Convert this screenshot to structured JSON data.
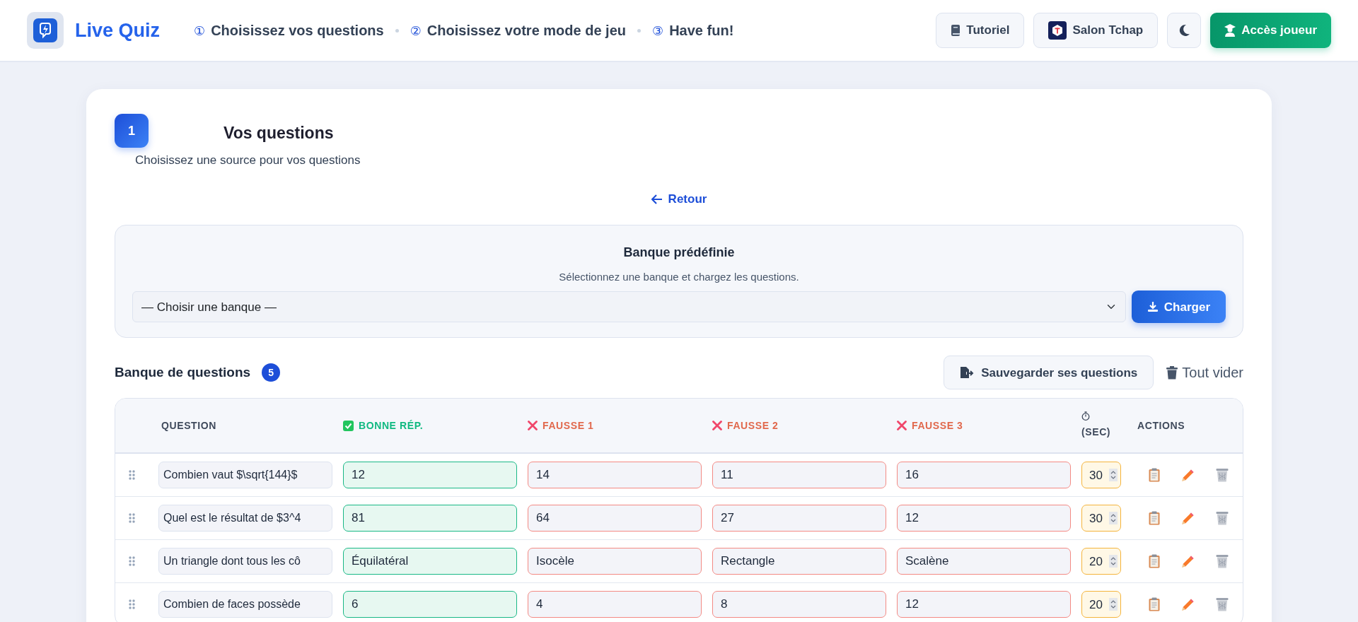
{
  "brand": {
    "name": "Live Quiz"
  },
  "steps": [
    {
      "number": "①",
      "label": "Choisissez vos questions"
    },
    {
      "number": "②",
      "label": "Choisissez votre mode de jeu"
    },
    {
      "number": "③",
      "label": "Have fun!"
    }
  ],
  "header_buttons": [
    {
      "kind": "tutorial",
      "label": "Tutoriel"
    },
    {
      "kind": "tchap",
      "label": "Salon Tchap"
    },
    {
      "kind": "theme"
    },
    {
      "kind": "player",
      "label": "Accès joueur"
    }
  ],
  "section": {
    "number": "1",
    "title": "Vos questions",
    "subtitle": "Choisissez une source pour vos questions"
  },
  "back_link": "Retour",
  "bank_panel": {
    "title": "Banque prédéfinie",
    "description": "Sélectionnez une banque et chargez les questions.",
    "select_value": "— Choisir une banque —",
    "load_button": "Charger"
  },
  "question_bank": {
    "title": "Banque de questions",
    "count": "5",
    "save_button": "Sauvegarder ses questions",
    "clear_button": "Tout vider"
  },
  "table": {
    "columns": [
      {
        "kind": "question",
        "label": "QUESTION"
      },
      {
        "kind": "correct",
        "label": "BONNE RÉP."
      },
      {
        "kind": "wrong",
        "label": "FAUSSE 1"
      },
      {
        "kind": "wrong",
        "label": "FAUSSE 2"
      },
      {
        "kind": "wrong",
        "label": "FAUSSE 3"
      },
      {
        "kind": "time",
        "label": "(SEC)"
      },
      {
        "kind": "actions",
        "label": "ACTIONS"
      }
    ],
    "rows": [
      {
        "question": "Combien vaut $\\sqrt{144}$",
        "correct": "12",
        "wrong": [
          "14",
          "11",
          "16"
        ],
        "time": "30"
      },
      {
        "question": "Quel est le résultat de $3^4",
        "correct": "81",
        "wrong": [
          "64",
          "27",
          "12"
        ],
        "time": "30"
      },
      {
        "question": "Un triangle dont tous les cô",
        "correct": "Équilatéral",
        "wrong": [
          "Isocèle",
          "Rectangle",
          "Scalène"
        ],
        "time": "20"
      },
      {
        "question": "Combien de faces possède",
        "correct": "6",
        "wrong": [
          "4",
          "8",
          "12"
        ],
        "time": "20"
      }
    ]
  }
}
